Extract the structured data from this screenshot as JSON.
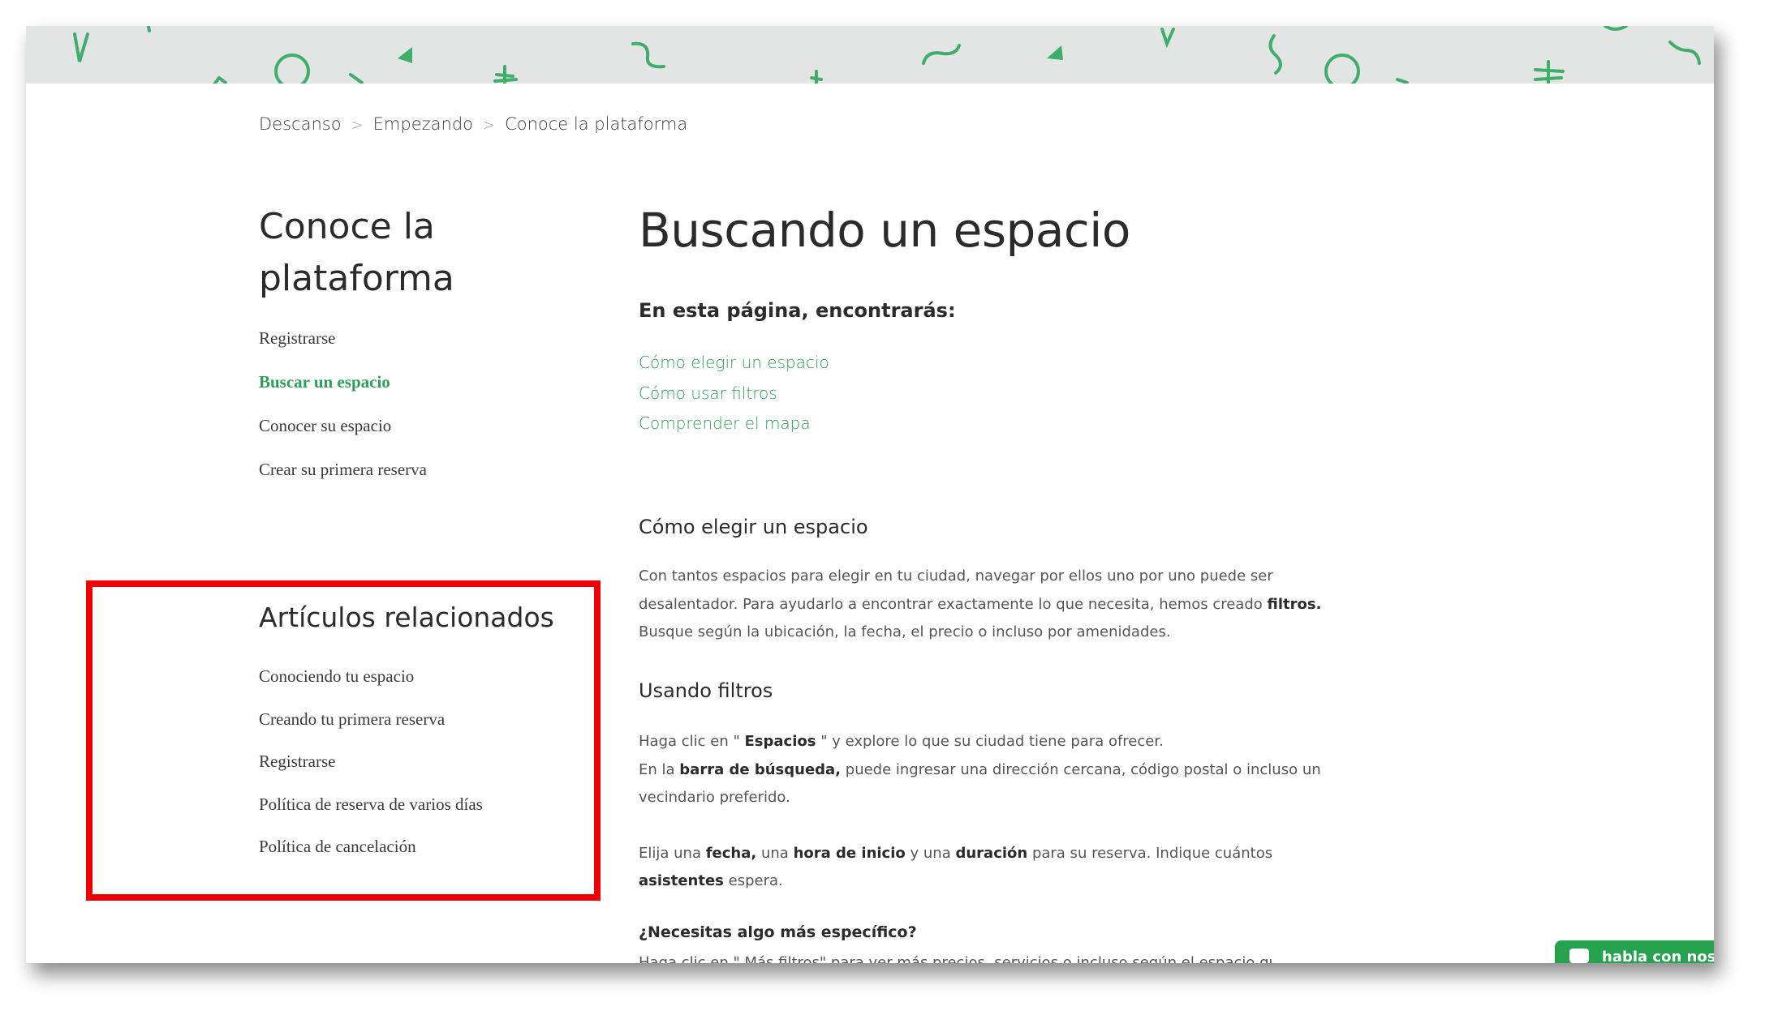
{
  "breadcrumb": [
    "Descanso",
    "Empezando",
    "Conoce la plataforma"
  ],
  "breadcrumb_separator": ">",
  "sidebar": {
    "title": "Conoce la plataforma",
    "items": [
      {
        "label": "Registrarse",
        "active": false
      },
      {
        "label": "Buscar un espacio",
        "active": true
      },
      {
        "label": "Conocer su espacio",
        "active": false
      },
      {
        "label": "Crear su primera reserva",
        "active": false
      }
    ]
  },
  "related": {
    "title": "Artículos relacionados",
    "items": [
      "Conociendo tu espacio",
      "Creando tu primera reserva",
      "Registrarse",
      "Política de reserva de varios días",
      "Política de cancelación"
    ]
  },
  "article": {
    "title": "Buscando un espacio",
    "toc_label": "En esta página, encontrarás:",
    "toc": [
      "Cómo elegir un espacio",
      "Cómo usar filtros",
      "Comprender el mapa"
    ],
    "section1_heading": "Cómo elegir un espacio",
    "section1_text_a": "Con tantos espacios para elegir en tu ciudad, navegar por ellos uno por uno puede ser desalentador. Para ayudarlo a encontrar exactamente lo que necesita, hemos creado",
    "section1_bold": "filtros.",
    "section1_text_b": "Busque según la ubicación, la fecha, el precio o incluso por amenidades.",
    "section2_heading": "Usando filtros",
    "p1_a": "Haga clic en \"",
    "p1_bold": "Espacios",
    "p1_b": "\" y explore lo que su ciudad tiene para ofrecer.",
    "p2_a": "En la",
    "p2_bold": "barra de búsqueda,",
    "p2_b": "puede ingresar una dirección cercana, código postal o incluso un vecindario preferido.",
    "p3_a": "Elija una",
    "p3_b1": "fecha,",
    "p3_c": "una",
    "p3_b2": "hora de inicio",
    "p3_d": "y una",
    "p3_b3": "duración",
    "p3_e": "para su reserva. Indique cuántos",
    "p3_b4": "asistentes",
    "p3_f": "espera.",
    "question": "¿Necesitas algo más específico?",
    "cut_line": "Haga clic en \" Más filtros\" para ver más precios, servicios o incluso según el espacio que"
  },
  "chat": {
    "label": "habla con nos"
  },
  "colors": {
    "accent": "#2e9d57",
    "highlight_border": "#ee0000",
    "banner": "#e3e5e4"
  }
}
